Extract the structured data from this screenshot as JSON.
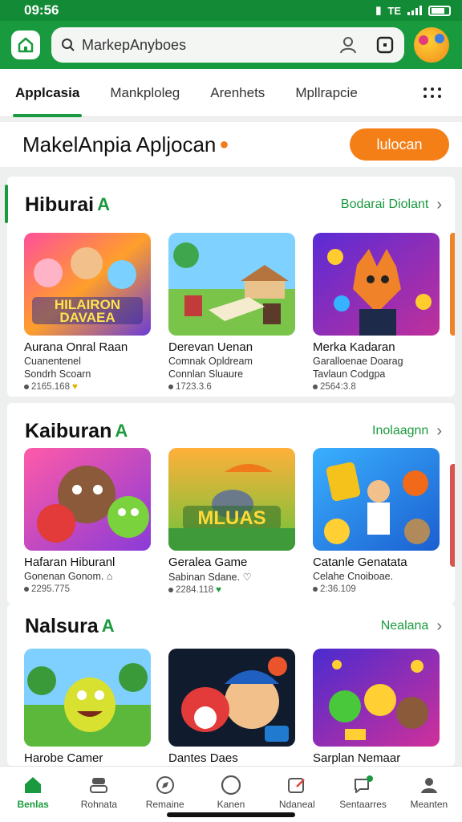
{
  "status": {
    "time": "09:56",
    "network": "TE"
  },
  "header": {
    "search_placeholder": "MarkepAnyboes"
  },
  "tabs": [
    {
      "label": "Applcasia",
      "active": true
    },
    {
      "label": "Mankploleg",
      "active": false
    },
    {
      "label": "Arenhets",
      "active": false
    },
    {
      "label": "Mpllrapcie",
      "active": false
    }
  ],
  "title_bar": {
    "title": "MakelAnpia Apljocan",
    "button": "lulocan"
  },
  "sections": [
    {
      "title": "Hiburai",
      "link": "Bodarai Diolant",
      "cards": [
        {
          "title": "Aurana Onral Raan",
          "line1": "Cuanentenel",
          "line2": "Sondrh Scoarn",
          "meta": "2165.168",
          "art_text": "HILAIRON DAVAEA"
        },
        {
          "title": "Derevan Uenan",
          "line1": "Comnak Opldream",
          "line2": "Connlan Sluaure",
          "meta": "1723.3.6",
          "art_text": ""
        },
        {
          "title": "Merka Kadaran",
          "line1": "Garalloenae Doarag",
          "line2": "Tavlaun Codgpa",
          "meta": "2564:3.8",
          "art_text": ""
        }
      ]
    },
    {
      "title": "Kaiburan",
      "link": "Inolaagnn",
      "cards": [
        {
          "title": "Hafaran Hiburanl",
          "line1": "Gonenan Gonom. ⌂",
          "line2": "",
          "meta": "2295.775",
          "art_text": ""
        },
        {
          "title": "Geralea Game",
          "line1": "Sabinan Sdane. ♡",
          "line2": "",
          "meta": "2284.118",
          "art_text": "MLUAS"
        },
        {
          "title": "Catanle Genatata",
          "line1": "Celahe Cnoiboae.",
          "line2": "",
          "meta": "2:36.109",
          "art_text": ""
        }
      ]
    },
    {
      "title": "Nalsura",
      "link": "Nealana",
      "cards": [
        {
          "title": "Harobe Camer",
          "line1": "",
          "line2": "",
          "meta": "",
          "art_text": ""
        },
        {
          "title": "Dantes Daes",
          "line1": "",
          "line2": "",
          "meta": "",
          "art_text": ""
        },
        {
          "title": "Sarplan Nemaar",
          "line1": "",
          "line2": "",
          "meta": "",
          "art_text": ""
        }
      ]
    }
  ],
  "bottom_nav": [
    {
      "label": "Benlas",
      "icon": "home-icon",
      "active": true
    },
    {
      "label": "Rohnata",
      "icon": "stack-icon",
      "active": false
    },
    {
      "label": "Remaine",
      "icon": "compass-icon",
      "active": false
    },
    {
      "label": "Kanen",
      "icon": "circle-icon",
      "active": false
    },
    {
      "label": "Ndaneal",
      "icon": "edit-icon",
      "active": false
    },
    {
      "label": "Sentaarres",
      "icon": "chat-icon",
      "active": false
    },
    {
      "label": "Meanten",
      "icon": "profile-icon",
      "active": false
    }
  ],
  "colors": {
    "brand_green": "#1a9a3e",
    "accent_orange": "#f57f17"
  }
}
